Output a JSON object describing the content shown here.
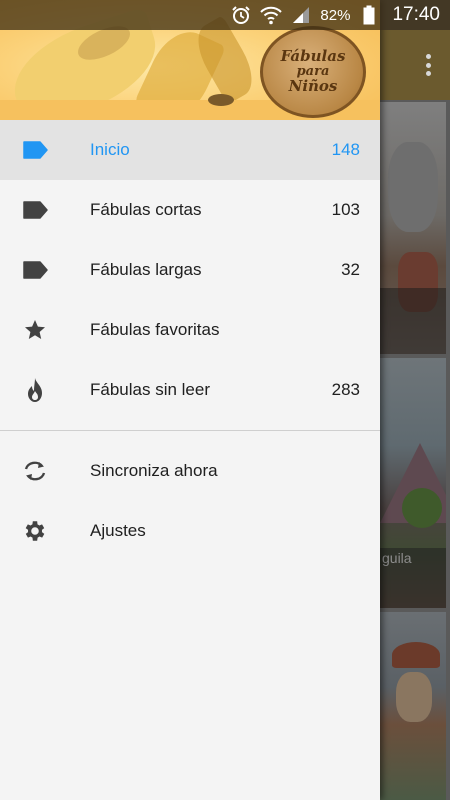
{
  "status_bar": {
    "battery_percent": "82%",
    "time": "17:40",
    "icons": [
      "alarm-icon",
      "wifi-icon",
      "signal-icon",
      "battery-icon"
    ]
  },
  "drawer_header": {
    "logo_lines": [
      "Fábulas",
      "para",
      "Niños"
    ]
  },
  "menu": {
    "items": [
      {
        "label": "Inicio",
        "count": "148",
        "icon": "label-tag-icon",
        "active": true
      },
      {
        "label": "Fábulas cortas",
        "count": "103",
        "icon": "label-tag-icon",
        "active": false
      },
      {
        "label": "Fábulas largas",
        "count": "32",
        "icon": "label-tag-icon",
        "active": false
      },
      {
        "label": "Fábulas favoritas",
        "count": "",
        "icon": "star-icon",
        "active": false
      },
      {
        "label": "Fábulas sin leer",
        "count": "283",
        "icon": "flame-icon",
        "active": false
      }
    ],
    "secondary": [
      {
        "label": "Sincroniza ahora",
        "icon": "sync-icon"
      },
      {
        "label": "Ajustes",
        "icon": "gear-icon"
      }
    ]
  },
  "background": {
    "card_caption_fragment": "guila"
  },
  "colors": {
    "accent": "#2196f3",
    "drawer_bg": "#f4f4f4",
    "active_row_bg": "#e3e3e3",
    "icon_gray": "#424242"
  }
}
